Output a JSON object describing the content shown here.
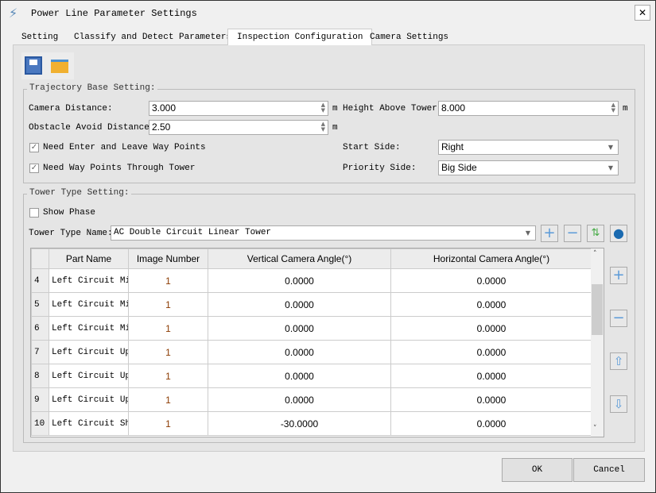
{
  "window": {
    "title": "Power Line Parameter Settings",
    "close": "✕"
  },
  "tabs": [
    {
      "label": "Setting"
    },
    {
      "label": "Classify and Detect Parameters"
    },
    {
      "label": "Inspection Configuration"
    },
    {
      "label": "Camera Settings"
    }
  ],
  "trajectory": {
    "title": "Trajectory Base Setting:",
    "camera_distance": {
      "label": "Camera Distance:",
      "value": "3.000",
      "unit": "m"
    },
    "height_above_tower": {
      "label": "Height Above Tower:",
      "value": "8.000",
      "unit": "m"
    },
    "obstacle_avoid": {
      "label": "Obstacle Avoid Distance:",
      "value": "2.50",
      "unit": "m"
    },
    "enter_leave": {
      "label": "Need Enter and Leave Way Points",
      "checked": true
    },
    "through_tower": {
      "label": "Need Way Points Through Tower",
      "checked": true
    },
    "start_side": {
      "label": "Start Side:",
      "value": "Right"
    },
    "priority_side": {
      "label": "Priority Side:",
      "value": "Big Side"
    }
  },
  "tower": {
    "title": "Tower Type Setting:",
    "show_phase": {
      "label": "Show Phase",
      "checked": false
    },
    "type_name": {
      "label": "Tower Type Name:",
      "value": "AC Double Circuit Linear Tower"
    }
  },
  "table": {
    "headers": [
      "",
      "Part Name",
      "Image Number",
      "Vertical Camera Angle(°)",
      "Horizontal Camera Angle(°)"
    ],
    "rows": [
      [
        "4",
        "Left Circuit Mi··",
        "1",
        "0.0000",
        "0.0000"
      ],
      [
        "5",
        "Left Circuit Mi··",
        "1",
        "0.0000",
        "0.0000"
      ],
      [
        "6",
        "Left Circuit Mi··",
        "1",
        "0.0000",
        "0.0000"
      ],
      [
        "7",
        "Left Circuit Up··",
        "1",
        "0.0000",
        "0.0000"
      ],
      [
        "8",
        "Left Circuit Up··",
        "1",
        "0.0000",
        "0.0000"
      ],
      [
        "9",
        "Left Circuit Up··",
        "1",
        "0.0000",
        "0.0000"
      ],
      [
        "10",
        "Left Circuit Shi",
        "1",
        "-30.0000",
        "0.0000"
      ]
    ]
  },
  "buttons": {
    "ok": "OK",
    "cancel": "Cancel"
  }
}
